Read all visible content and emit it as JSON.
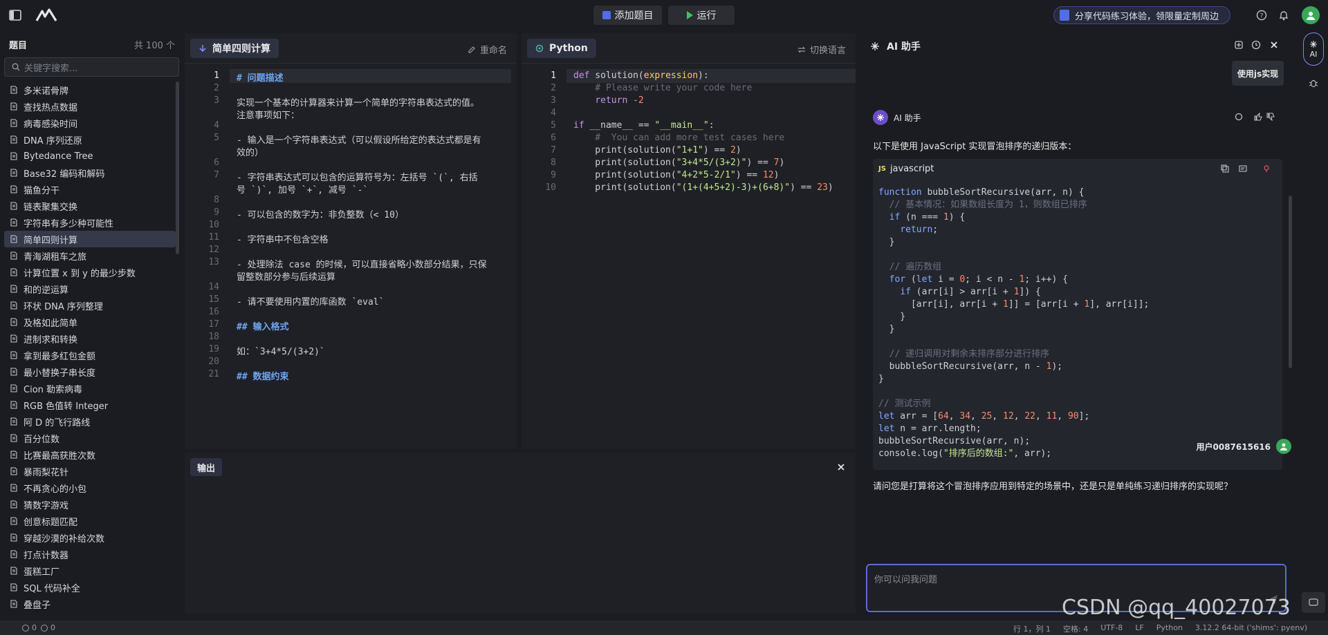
{
  "topbar": {
    "add_problem_label": "添加题目",
    "run_label": "运行",
    "share_text": "分享代码练习体验，领限量定制周边"
  },
  "sidebar": {
    "title": "题目",
    "count": "共 100 个",
    "search_placeholder": "关键字搜索...",
    "items": [
      "多米诺骨牌",
      "查找热点数据",
      "病毒感染时间",
      "DNA 序列还原",
      "Bytedance Tree",
      "Base32 编码和解码",
      "猫鱼分干",
      "链表聚集交换",
      "字符串有多少种可能性",
      "简单四则计算",
      "青海湖租车之旅",
      "计算位置 x 到 y 的最少步数",
      "和的逆运算",
      "环状 DNA 序列整理",
      "及格如此简单",
      "进制求和转换",
      "拿到最多红包金额",
      "最小替换子串长度",
      "Cion 勒索病毒",
      "RGB 色值转 Integer",
      "阿 D 的飞行路线",
      "百分位数",
      "比赛最高获胜次数",
      "暴雨梨花针",
      "不再贪心的小包",
      "猜数字游戏",
      "创意标题匹配",
      "穿越沙漠的补给次数",
      "打点计数器",
      "蛋糕工厂",
      "SQL 代码补全",
      "叠盘子"
    ],
    "active_index": 9
  },
  "problem_panel": {
    "tab_label": "简单四则计算",
    "rename_label": "重命名",
    "lines": [
      {
        "n": "1",
        "t": "# 问题描述",
        "cls": "md-h"
      },
      {
        "n": "2",
        "t": "",
        "cls": ""
      },
      {
        "n": "3",
        "t": "实现一个基本的计算器来计算一个简单的字符串表达式的值。",
        "cls": ""
      },
      {
        "n": "",
        "t": "注意事项如下：",
        "cls": ""
      },
      {
        "n": "4",
        "t": "",
        "cls": ""
      },
      {
        "n": "5",
        "t": "- 输入是一个字符串表达式（可以假设所给定的表达式都是有",
        "cls": ""
      },
      {
        "n": "",
        "t": "效的）",
        "cls": ""
      },
      {
        "n": "6",
        "t": "",
        "cls": ""
      },
      {
        "n": "7",
        "t": "- 字符串表达式可以包含的运算符号为：左括号 `(`, 右括",
        "cls": ""
      },
      {
        "n": "",
        "t": "号 `)`, 加号 `+`, 减号 `-`",
        "cls": ""
      },
      {
        "n": "8",
        "t": "",
        "cls": ""
      },
      {
        "n": "9",
        "t": "- 可以包含的数字为：非负整数（< 10）",
        "cls": ""
      },
      {
        "n": "10",
        "t": "",
        "cls": ""
      },
      {
        "n": "11",
        "t": "- 字符串中不包含空格",
        "cls": ""
      },
      {
        "n": "12",
        "t": "",
        "cls": ""
      },
      {
        "n": "13",
        "t": "- 处理除法 case 的时候，可以直接省略小数部分结果，只保",
        "cls": ""
      },
      {
        "n": "",
        "t": "留整数部分参与后续运算",
        "cls": ""
      },
      {
        "n": "14",
        "t": "",
        "cls": ""
      },
      {
        "n": "15",
        "t": "- 请不要使用内置的库函数 `eval`",
        "cls": ""
      },
      {
        "n": "16",
        "t": "",
        "cls": ""
      },
      {
        "n": "17",
        "t": "## 输入格式",
        "cls": "md-h"
      },
      {
        "n": "18",
        "t": "",
        "cls": ""
      },
      {
        "n": "19",
        "t": "如：`3+4*5/(3+2)`",
        "cls": ""
      },
      {
        "n": "20",
        "t": "",
        "cls": ""
      },
      {
        "n": "21",
        "t": "## 数据约束",
        "cls": "md-h"
      }
    ]
  },
  "code_panel": {
    "tab_label": "Python",
    "switch_label": "切换语言",
    "lines": [
      {
        "n": "1",
        "t": "def solution(expression):"
      },
      {
        "n": "2",
        "t": "    # Please write your code here"
      },
      {
        "n": "3",
        "t": "    return -2"
      },
      {
        "n": "4",
        "t": ""
      },
      {
        "n": "5",
        "t": "if __name__ == \"__main__\":"
      },
      {
        "n": "6",
        "t": "    #  You can add more test cases here"
      },
      {
        "n": "7",
        "t": "    print(solution(\"1+1\") == 2)"
      },
      {
        "n": "8",
        "t": "    print(solution(\"3+4*5/(3+2)\") == 7)"
      },
      {
        "n": "9",
        "t": "    print(solution(\"4+2*5-2/1\") == 12)"
      },
      {
        "n": "10",
        "t": "    print(solution(\"(1+(4+5+2)-3)+(6+8)\") == 23)"
      }
    ]
  },
  "output_panel": {
    "tab_label": "输出"
  },
  "ai_panel": {
    "title": "AI 助手",
    "chip_text": "使用js实现",
    "assistant_name": "AI 助手",
    "intro": "以下是使用 JavaScript 实现冒泡排序的递归版本：",
    "code_lang": "javascript",
    "code": "function bubbleSortRecursive(arr, n) {\n  // 基本情况：如果数组长度为 1，则数组已排序\n  if (n === 1) {\n    return;\n  }\n\n  // 遍历数组\n  for (let i = 0; i < n - 1; i++) {\n    if (arr[i] > arr[i + 1]) {\n      [arr[i], arr[i + 1]] = [arr[i + 1], arr[i]];\n    }\n  }\n\n  // 递归调用对剩余未排序部分进行排序\n  bubbleSortRecursive(arr, n - 1);\n}\n\n// 测试示例\nlet arr = [64, 34, 25, 12, 22, 11, 90];\nlet n = arr.length;\nbubbleSortRecursive(arr, n);\nconsole.log(\"排序后的数组:\", arr);",
    "question": "请问您是打算将这个冒泡排序应用到特定的场景中，还是只是单纯练习递归排序的实现呢？",
    "user_name": "用户0087615616",
    "input_placeholder": "你可以问我问题"
  },
  "right_strip": {
    "ai_label": "AI"
  },
  "statusbar": {
    "errors": "0",
    "warnings": "0",
    "position": "行 1，列 1",
    "spaces": "空格: 4",
    "encoding": "UTF-8",
    "eol": "LF",
    "language": "Python",
    "interpreter": "3.12.2 64-bit ('shims': pyenv)"
  },
  "watermark": "CSDN @qq_40027073"
}
